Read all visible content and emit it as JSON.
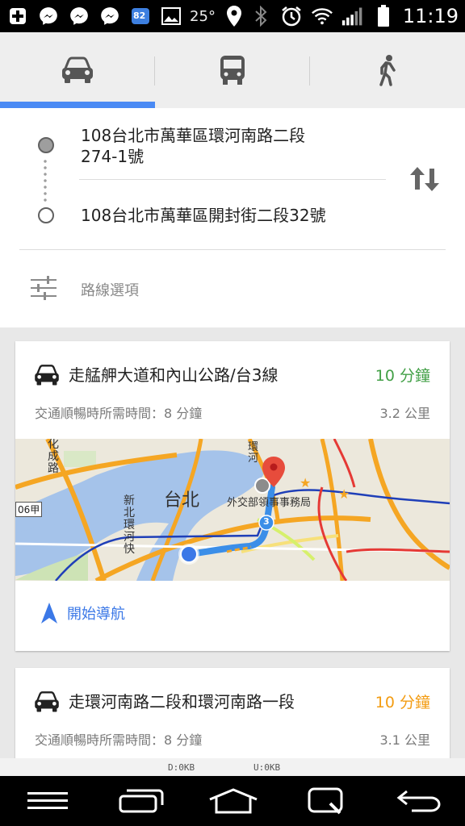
{
  "statusbar": {
    "battery_temp": "82",
    "temperature": "25°",
    "time": "11:19"
  },
  "mode_tabs": [
    {
      "icon": "car-icon",
      "selected": true
    },
    {
      "icon": "transit-icon",
      "selected": false
    },
    {
      "icon": "walk-icon",
      "selected": false
    }
  ],
  "directions": {
    "origin": "108台北市萬華區環河南路二段274-1號",
    "destination": "108台北市萬華區開封街二段32號",
    "options_label": "路線選項"
  },
  "routes": [
    {
      "title": "走艋舺大道和內山公路/台3線",
      "duration": "10 分鐘",
      "duration_color": "#43a047",
      "subtitle": "交通順暢時所需時間：8 分鐘",
      "distance": "3.2 公里",
      "map_labels": {
        "city": "台北",
        "poi": "外交部領事事務局",
        "road1": "化成路",
        "road2": "新北環河快",
        "road3": "環河",
        "road_badge": "3",
        "route_sign": "06甲"
      },
      "start_nav_label": "開始導航"
    },
    {
      "title": "走環河南路二段和環河南路一段",
      "duration": "10 分鐘",
      "duration_color": "#f39c12",
      "subtitle": "交通順暢時所需時間：8 分鐘",
      "distance": "3.1 公里"
    }
  ],
  "netbar": {
    "down": "D:0KB",
    "up": "U:0KB"
  },
  "colors": {
    "accent": "#4a8af4",
    "route_line": "#3b8ee8"
  }
}
